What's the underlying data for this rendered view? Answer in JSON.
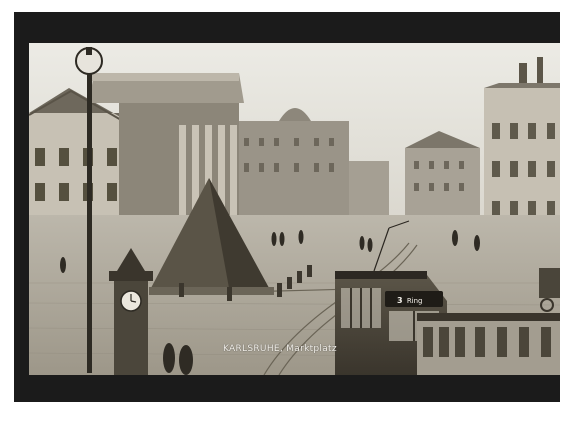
{
  "photo": {
    "caption": "KARLSRUHE, Marktplatz",
    "tram_route_number": "3",
    "tram_route_name": "Ring",
    "clock_face": "clock-icon"
  }
}
